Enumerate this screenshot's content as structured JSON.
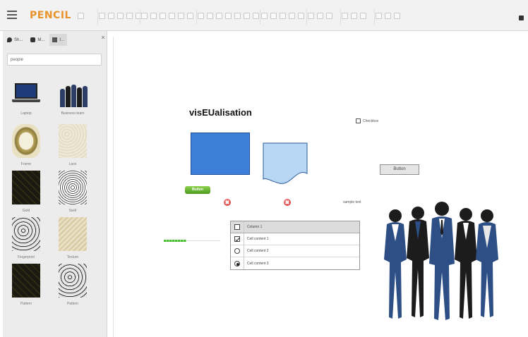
{
  "app": {
    "name": "PENCIL"
  },
  "toolbar": {
    "groups": [
      {
        "label": "",
        "count": 1
      },
      {
        "label": "",
        "count": 5
      },
      {
        "label": "",
        "count": 6
      },
      {
        "label": "",
        "count": 7
      },
      {
        "label": "",
        "count": 5
      },
      {
        "label": "",
        "count": 3
      },
      {
        "label": "",
        "count": 3
      },
      {
        "label": "",
        "count": 3
      }
    ]
  },
  "sidebar": {
    "tabs": [
      {
        "label": "Sh..."
      },
      {
        "label": "M..."
      },
      {
        "label": "I..."
      }
    ],
    "close_label": "×",
    "search": {
      "value": "people",
      "placeholder": ""
    },
    "thumbnails": [
      {
        "caption": "Laptop",
        "kind": "laptop"
      },
      {
        "caption": "Business team",
        "kind": "team-small"
      },
      {
        "caption": "Frame",
        "kind": "frame"
      },
      {
        "caption": "Lace",
        "kind": "lace"
      },
      {
        "caption": "Gold",
        "kind": "darkgold"
      },
      {
        "caption": "Swirl",
        "kind": "bwswirl"
      },
      {
        "caption": "Fingerprint",
        "kind": "bwcircles"
      },
      {
        "caption": "Texture",
        "kind": "beige"
      },
      {
        "caption": "Pattern",
        "kind": "darkgold"
      },
      {
        "caption": "Pattern",
        "kind": "bwcircles"
      }
    ]
  },
  "canvas": {
    "title": "visEUalisation",
    "checkbox_label": "Checkbox",
    "button_label": "Button",
    "green_button_label": "Button",
    "sample_text": "sample text",
    "slider": {
      "value_fraction": 0.4
    },
    "table": {
      "header": "Column 1",
      "rows": [
        {
          "label": "Cell content 1",
          "control": "checkbox",
          "checked": true
        },
        {
          "label": "Cell content 2",
          "control": "radio",
          "checked": false
        },
        {
          "label": "Cell content 3",
          "control": "radio",
          "checked": true
        }
      ]
    }
  },
  "colors": {
    "brand": "#e8932a",
    "rect_fill": "#3d7fd8",
    "wave_fill": "#b8d7f5",
    "green_button": "#5aaa2a",
    "error_red": "#c81e1e",
    "people_blue": "#2d4f86"
  }
}
